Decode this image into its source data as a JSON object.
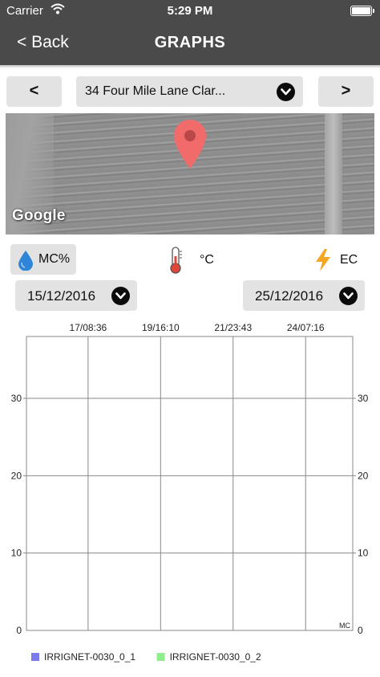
{
  "status_bar": {
    "carrier": "Carrier",
    "time": "5:29 PM"
  },
  "nav": {
    "back_label": "< Back",
    "title": "GRAPHS"
  },
  "location": {
    "prev_label": "<",
    "next_label": ">",
    "address": "34 Four Mile Lane Clar..."
  },
  "map": {
    "attribution": "Google"
  },
  "measures": {
    "mc_label": "MC%",
    "temp_label": "°C",
    "ec_label": "EC",
    "active": "MC%"
  },
  "dates": {
    "start": "15/12/2016",
    "end": "25/12/2016"
  },
  "colors": {
    "nav_bg": "#4a4a4a",
    "pin": "#f26b6b",
    "drop": "#2f86d9",
    "bolt": "#f5a623",
    "series_1": "#7b7bef",
    "series_2": "#8fef8f"
  },
  "chart_data": {
    "type": "line",
    "x_tick_labels": [
      "17/08:36",
      "19/16:10",
      "21/23:43",
      "24/07:16"
    ],
    "y_ticks": [
      0,
      10,
      20,
      30
    ],
    "ylim": [
      0,
      38
    ],
    "y_axis_unit": "MC",
    "grid": true,
    "legend_position": "bottom-left",
    "series": [
      {
        "name": "IRRIGNET-0030_0_1",
        "color": "#7b7bef",
        "values": []
      },
      {
        "name": "IRRIGNET-0030_0_2",
        "color": "#8fef8f",
        "values": []
      }
    ]
  }
}
